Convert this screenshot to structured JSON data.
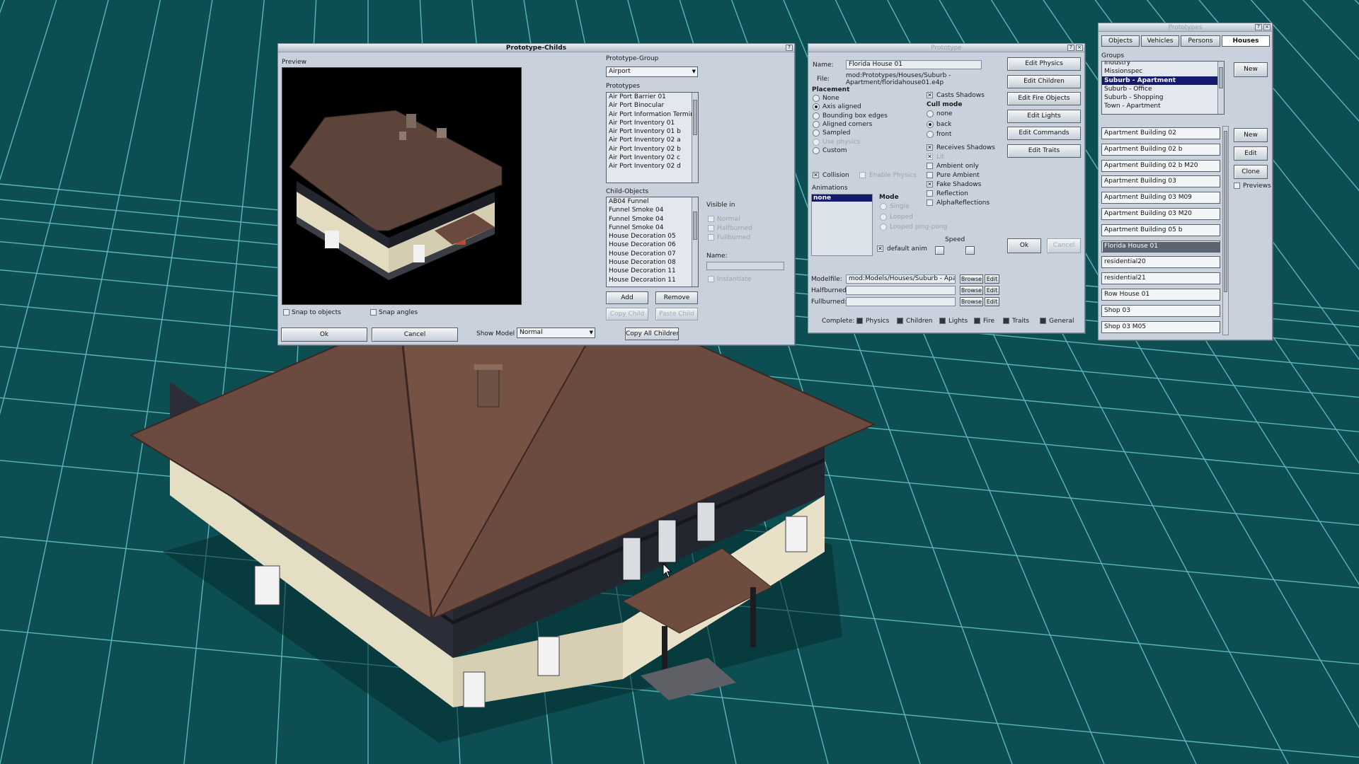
{
  "colors": {
    "grid_bg": "#0d4e52",
    "grid_line": "#69c8cc",
    "window_bg": "#c9d2dc",
    "selection": "#141b6e",
    "roof": "#6b4a3f",
    "wall_dark": "#2a2d36",
    "wall_light": "#e6dfc4"
  },
  "childs": {
    "title": "Prototype-Childs",
    "preview_label": "Preview",
    "group_label": "Prototype-Group",
    "group_value": "Airport",
    "prototypes_label": "Prototypes",
    "prototypes": [
      "Air Port Barrier 01",
      "Air Port Binocular",
      "Air Port Information Termin",
      "Air Port Inventory 01",
      "Air Port Inventory 01 b",
      "Air Port Inventory 02 a",
      "Air Port Inventory 02 b",
      "Air Port Inventory 02 c",
      "Air Port Inventory 02 d"
    ],
    "child_objects_label": "Child-Objects",
    "child_objects": [
      "AB04 Funnel",
      "Funnel Smoke 04",
      "Funnel Smoke 04",
      "Funnel Smoke 04",
      "House Decoration 05",
      "House Decoration 06",
      "House Decoration 07",
      "House Decoration 08",
      "House Decoration 11",
      "House Decoration 11"
    ],
    "visible_in_label": "Visible in",
    "visible_normal": "Normal",
    "visible_halfburned": "Halfburned",
    "visible_fullburned": "Fullburned",
    "name_label": "Name:",
    "instantiate": "Instantiate",
    "add": "Add",
    "remove": "Remove",
    "copy_child": "Copy Child",
    "paste_child": "Paste Child",
    "copy_all_children": "Copy All Children",
    "snap_objects": "Snap to objects",
    "snap_angles": "Snap angles",
    "ok": "Ok",
    "cancel": "Cancel",
    "show_model_label": "Show Model",
    "show_model_value": "Normal"
  },
  "proto": {
    "title": "Prototype",
    "name_label": "Name:",
    "name_value": "Florida House 01",
    "file_label": "File:",
    "file_value_1": "mod:Prototypes/Houses/Suburb -",
    "file_value_2": "Apartment/floridahouse01.e4p",
    "placement_label": "Placement",
    "placement": [
      "None",
      "Axis aligned",
      "Bounding box edges",
      "Aligned corners",
      "Sampled",
      "Use physics",
      "Custom"
    ],
    "placement_selected": 1,
    "collision": "Collision",
    "enable_physics": "Enable Physics",
    "casts_shadows": "Casts Shadows",
    "cull_mode_label": "Cull mode",
    "cull": [
      "none",
      "back",
      "front"
    ],
    "cull_selected": 1,
    "receives_shadows": "Receives Shadows",
    "lit": "Lit",
    "ambient_only": "Ambient only",
    "pure_ambient": "Pure Ambient",
    "fake_shadows": "Fake Shadows",
    "reflection": "Reflection",
    "alpha_reflections": "AlphaReflections",
    "animations_label": "Animations",
    "anim_selected": "none",
    "mode_label": "Mode",
    "modes": [
      "Single",
      "Looped",
      "Looped ping-pong"
    ],
    "speed_label": "Speed",
    "default_anim": "default anim",
    "buttons": [
      "Edit Physics",
      "Edit Children",
      "Edit Fire Objects",
      "Edit Lights",
      "Edit Commands",
      "Edit Traits"
    ],
    "ok": "Ok",
    "cancel": "Cancel",
    "modelfile_label": "Modelfile:",
    "modelfile_value": "mod:Models/Houses/Suburb - Apart",
    "halfburned_label": "Halfburned:",
    "fullburned_label": "Fullburned:",
    "browse": "Browse",
    "edit": "Edit",
    "complete_label": "Complete:",
    "complete": [
      "Physics",
      "Children",
      "Lights",
      "Fire",
      "Traits",
      "General"
    ]
  },
  "types": {
    "title": "Prototypes",
    "tabs": [
      "Objects",
      "Vehicles",
      "Persons",
      "Houses"
    ],
    "active_tab": "Houses",
    "groups_label": "Groups",
    "groups": [
      "Industry",
      "Missionspec",
      "Suburb - Apartment",
      "Suburb - Office",
      "Suburb - Shopping",
      "Town - Apartment"
    ],
    "groups_selected": 2,
    "new_group": "New",
    "items": [
      "Apartment Building 02",
      "Apartment Building 02 b",
      "Apartment Building 02 b M20",
      "Apartment Building 03",
      "Apartment Building 03 M09",
      "Apartment Building 03 M20",
      "Apartment Building 05 b",
      "Florida House 01",
      "residential20",
      "residential21",
      "Row House 01",
      "Shop 03",
      "Shop 03 M05"
    ],
    "items_selected": 7,
    "new": "New",
    "edit": "Edit",
    "clone": "Clone",
    "previews": "Previews"
  }
}
